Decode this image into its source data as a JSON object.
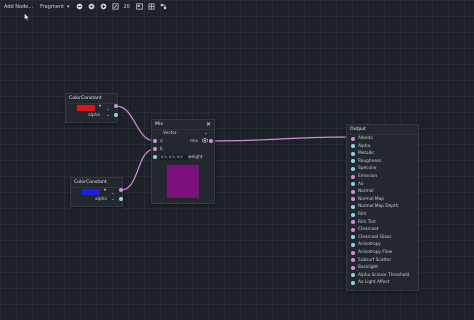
{
  "toolbar": {
    "add_node": "Add Node...",
    "shader_mode": "Fragment",
    "zoom": "20"
  },
  "colors": {
    "vector_port": "#d68ad9",
    "scalar_port": "#86d7e0",
    "mix_preview": "#7d107d"
  },
  "color_constant_1": {
    "title": "ColorConstant",
    "swatch_color": "#e0131b",
    "alpha_label": "alpha"
  },
  "color_constant_2": {
    "title": "ColorConstant",
    "swatch_color": "#1c1ee6",
    "alpha_label": "alpha"
  },
  "mix": {
    "title": "Mix",
    "type": "Vector",
    "input_a": "a",
    "input_b": "b",
    "weight_value": "0.5, 0.5, 0.5",
    "weight_label": "weight",
    "output_label": "mix"
  },
  "output": {
    "title": "Output",
    "ports": [
      "Albedo",
      "Alpha",
      "Metallic",
      "Roughness",
      "Specular",
      "Emission",
      "Ao",
      "Normal",
      "Normal Map",
      "Normal Map Depth",
      "Rim",
      "Rim Tint",
      "Clearcoat",
      "Clearcoat Gloss",
      "Anisotropy",
      "Anisotropy Flow",
      "Subsurf Scatter",
      "Backlight",
      "Alpha Scissor Threshold",
      "Ao Light Affect"
    ]
  }
}
